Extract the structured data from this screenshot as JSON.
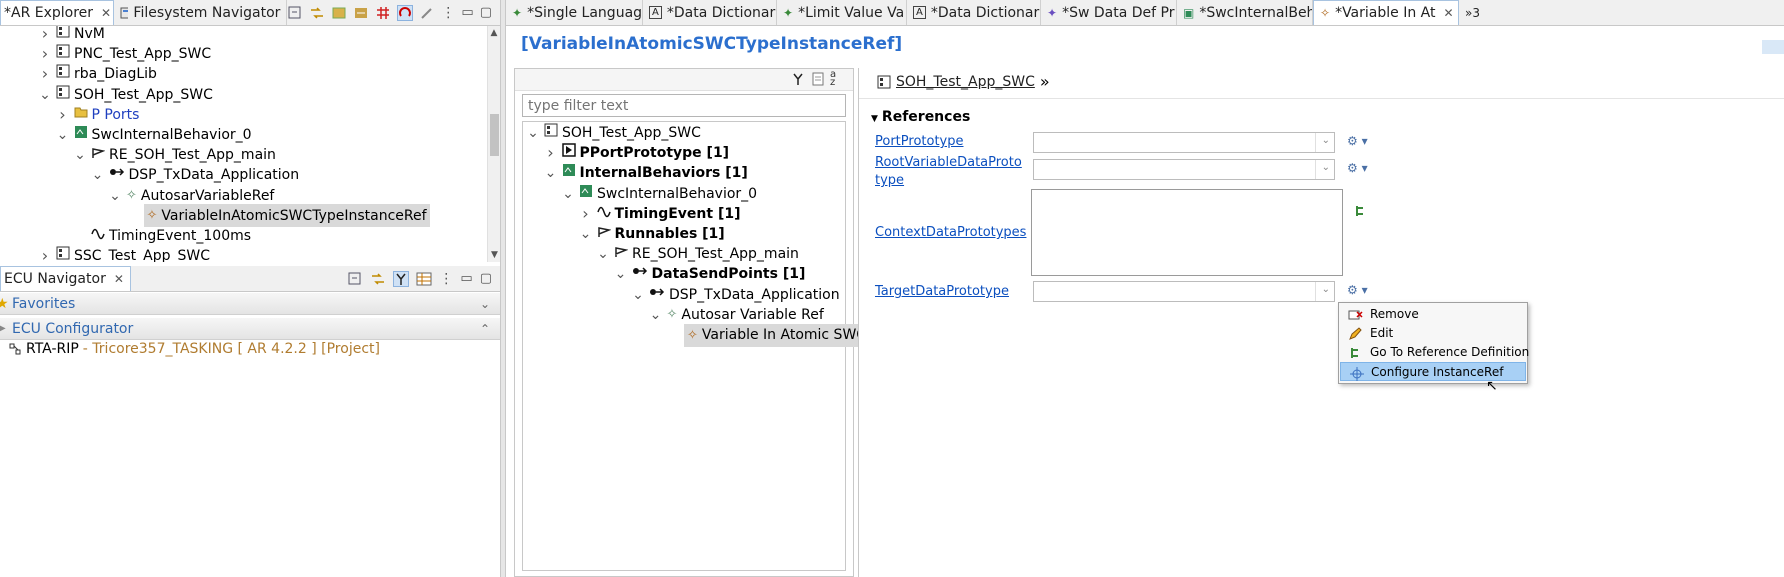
{
  "left_tabs": [
    {
      "label": "*AR Explorer",
      "active": true
    },
    {
      "label": "Filesystem Navigator",
      "active": false
    }
  ],
  "ar_tree": [
    {
      "label": "NvM",
      "indent": 0,
      "chev": ">"
    },
    {
      "label": "PNC_Test_App_SWC",
      "indent": 0,
      "chev": ">"
    },
    {
      "label": "rba_DiagLib",
      "indent": 0,
      "chev": ">"
    },
    {
      "label": "SOH_Test_App_SWC",
      "indent": 0,
      "chev": "v"
    },
    {
      "label": "P Ports",
      "indent": 1,
      "chev": ">",
      "blue": true
    },
    {
      "label": "SwcInternalBehavior_0",
      "indent": 1,
      "chev": "v"
    },
    {
      "label": "RE_SOH_Test_App_main",
      "indent": 2,
      "chev": "v"
    },
    {
      "label": "DSP_TxData_Application",
      "indent": 3,
      "chev": "v"
    },
    {
      "label": "AutosarVariableRef",
      "indent": 4,
      "chev": "v"
    },
    {
      "label": "VariableInAtomicSWCTypeInstanceRef",
      "indent": 5,
      "chev": "",
      "selected": true
    },
    {
      "label": "TimingEvent_100ms",
      "indent": 2,
      "chev": ""
    },
    {
      "label": "SSC_Test_App_SWC",
      "indent": 0,
      "chev": ">"
    }
  ],
  "ecu_nav": {
    "tab_label": "ECU Navigator",
    "favorites": "Favorites",
    "configurator": "ECU Configurator",
    "project_name": "RTA-RIP",
    "project_detail": " - Tricore357_TASKING [ AR 4.2.2 ] [Project]"
  },
  "editor_tabs": [
    {
      "label": "*Single Languag"
    },
    {
      "label": "*Data Dictionar"
    },
    {
      "label": "*Limit Value Va"
    },
    {
      "label": "*Data Dictionar"
    },
    {
      "label": "*Sw Data Def Pr"
    },
    {
      "label": "*SwcInternalBeh"
    },
    {
      "label": "*Variable In At",
      "active": true
    }
  ],
  "overflow_label": "»3",
  "editor_title": "[VariableInAtomicSWCTypeInstanceRef]",
  "filter": {
    "placeholder": "type filter text"
  },
  "mid_tree": [
    {
      "label": "SOH_Test_App_SWC",
      "indent": 0,
      "chev": "v"
    },
    {
      "label": "PPortPrototype [1]",
      "indent": 1,
      "chev": ">",
      "bold": true
    },
    {
      "label": "InternalBehaviors [1]",
      "indent": 1,
      "chev": "v",
      "bold": true
    },
    {
      "label": "SwcInternalBehavior_0",
      "indent": 2,
      "chev": "v"
    },
    {
      "label": "TimingEvent [1]",
      "indent": 3,
      "chev": ">",
      "bold": true
    },
    {
      "label": "Runnables [1]",
      "indent": 3,
      "chev": "v",
      "bold": true
    },
    {
      "label": "RE_SOH_Test_App_main",
      "indent": 4,
      "chev": "v"
    },
    {
      "label": "DataSendPoints [1]",
      "indent": 5,
      "chev": "v",
      "bold": true
    },
    {
      "label": "DSP_TxData_Application",
      "indent": 6,
      "chev": "v"
    },
    {
      "label": "Autosar Variable Ref",
      "indent": 7,
      "chev": "v"
    },
    {
      "label": "Variable In Atomic SWC",
      "indent": 8,
      "chev": "",
      "selected": true
    }
  ],
  "breadcrumb": {
    "label": "SOH_Test_App_SWC",
    "suffix": "»"
  },
  "references": {
    "section_title": "References",
    "port_prototype": "PortPrototype",
    "root_variable": "RootVariableDataPrototype",
    "context": "ContextDataPrototypes",
    "target": "TargetDataPrototype"
  },
  "context_menu": [
    {
      "label": "Remove"
    },
    {
      "label": "Edit"
    },
    {
      "label": "Go To Reference Definition"
    },
    {
      "label": "Configure InstanceRef",
      "highlighted": true
    }
  ]
}
